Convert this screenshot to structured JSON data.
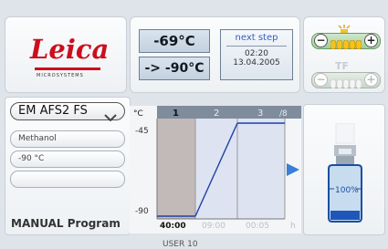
{
  "logo": {
    "brand": "Leica",
    "sub": "MICROSYSTEMS"
  },
  "temps": {
    "current": "-69°C",
    "target": "-> -90°C"
  },
  "next_step": {
    "label": "next step",
    "time": "02:20",
    "date": "13.04.2005"
  },
  "light": {
    "minus": "−",
    "plus": "+"
  },
  "tf": {
    "label": "TF",
    "minus": "−",
    "plus": "+"
  },
  "device": {
    "model": "EM AFS2 FS"
  },
  "fields": {
    "medium": "Methanol",
    "temperature": "-90 °C",
    "empty": ""
  },
  "mode": {
    "label": "MANUAL Program"
  },
  "user": {
    "label": "USER 10"
  },
  "chart": {
    "unit": "°C",
    "steps": [
      "1",
      "2",
      "3"
    ],
    "step_total": "/8",
    "y_top": "-45",
    "y_bottom": "-90",
    "times": [
      "40:00",
      "09:00",
      "00:05"
    ],
    "time_unit": "h"
  },
  "reservoir": {
    "level": "100%"
  },
  "colors": {
    "logo_red": "#cc0e1d",
    "chart_line": "#1f3fa5",
    "arrow": "#3a7fd5",
    "header_bar": "#7f8c9c"
  }
}
